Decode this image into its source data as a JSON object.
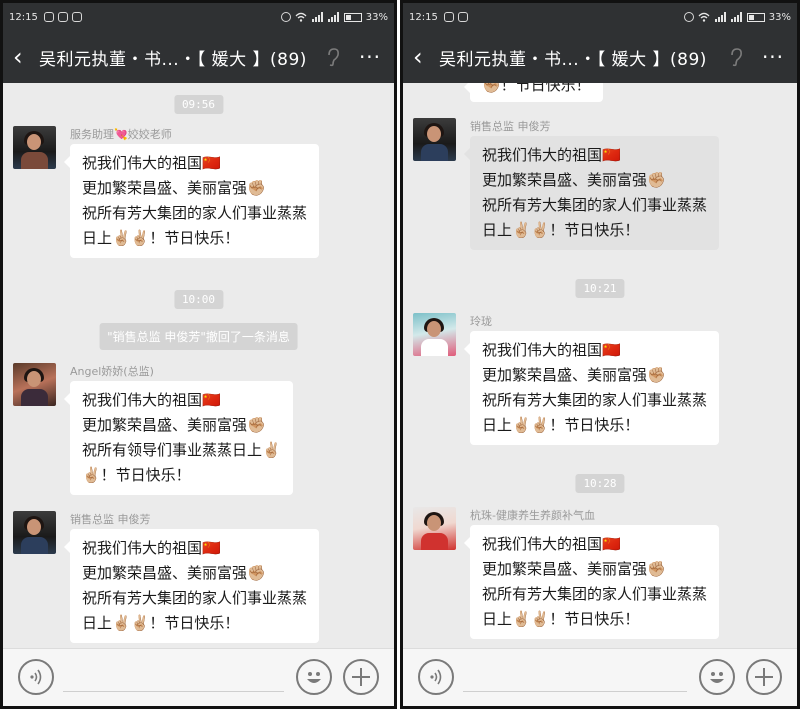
{
  "status": {
    "time": "12:15",
    "battery": "33%"
  },
  "header": {
    "back": "<",
    "title": "吴利元执董・书...・【 媛大 】(89)",
    "more": "···"
  },
  "left": {
    "messages": [
      {
        "type": "time",
        "text": "09:56"
      },
      {
        "type": "msg",
        "sender": "服务助理💘姣姣老师",
        "lines": [
          "祝我们伟大的祖国🇨🇳",
          "更加繁荣昌盛、美丽富强✊🏼",
          "祝所有芳大集团的家人们事业蒸蒸",
          "日上✌🏼✌🏼！节日快乐！"
        ]
      },
      {
        "type": "time",
        "text": "10:00"
      },
      {
        "type": "system",
        "text": "\"销售总监 申俊芳\"撤回了一条消息"
      },
      {
        "type": "msg",
        "sender": "Angel娇娇(总监)",
        "lines": [
          "祝我们伟大的祖国🇨🇳",
          "更加繁荣昌盛、美丽富强✊🏼",
          "祝所有领导们事业蒸蒸日上✌🏼",
          "✌🏼！节日快乐！"
        ]
      },
      {
        "type": "msg",
        "sender": "销售总监 申俊芳",
        "lines": [
          "祝我们伟大的祖国🇨🇳",
          "更加繁荣昌盛、美丽富强✊🏼",
          "祝所有芳大集团的家人们事业蒸蒸",
          "日上✌🏼✌🏼！节日快乐！"
        ]
      }
    ]
  },
  "right": {
    "top_partial": "✊🏼！节日快乐！",
    "messages": [
      {
        "type": "msg",
        "sender": "销售总监 申俊芳",
        "lines": [
          "祝我们伟大的祖国🇨🇳",
          "更加繁荣昌盛、美丽富强✊🏼",
          "祝所有芳大集团的家人们事业蒸蒸",
          "日上✌🏼✌🏼！节日快乐！"
        ]
      },
      {
        "type": "time",
        "text": "10:21"
      },
      {
        "type": "msg",
        "sender": "玲珑",
        "lines": [
          "祝我们伟大的祖国🇨🇳",
          "更加繁荣昌盛、美丽富强✊🏼",
          "祝所有芳大集团的家人们事业蒸蒸",
          "日上✌🏼✌🏼！节日快乐！"
        ]
      },
      {
        "type": "time",
        "text": "10:28"
      },
      {
        "type": "msg",
        "sender": "杭珠-健康养生养颜补气血",
        "lines": [
          "祝我们伟大的祖国🇨🇳",
          "更加繁荣昌盛、美丽富强✊🏼",
          "祝所有芳大集团的家人们事业蒸蒸",
          "日上✌🏼✌🏼！节日快乐！"
        ]
      }
    ]
  },
  "icons": {
    "back": "back-arrow-icon",
    "ear": "earpiece-icon",
    "more": "more-icon",
    "voice": "voice-icon",
    "emoji": "emoji-icon",
    "plus": "plus-icon"
  }
}
